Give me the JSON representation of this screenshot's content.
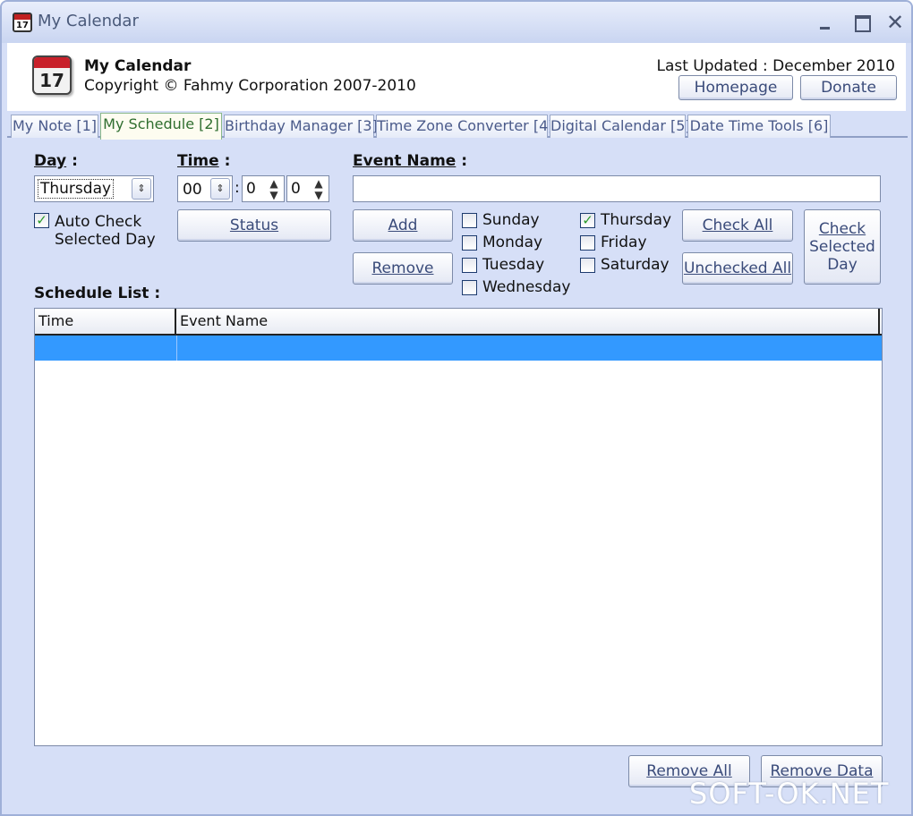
{
  "window": {
    "title": "My Calendar",
    "icon_day": "17"
  },
  "header": {
    "app_name": "My Calendar",
    "copyright": "Copyright © Fahmy Corporation 2007-2010",
    "last_updated": "Last Updated : December 2010",
    "homepage_label": "Homepage",
    "donate_label": "Donate"
  },
  "tabs": [
    {
      "label": "My Note [1]",
      "active": false
    },
    {
      "label": "My Schedule [2]",
      "active": true
    },
    {
      "label": "Birthday Manager [3]",
      "active": false
    },
    {
      "label": "Time Zone Converter [4]",
      "active": false
    },
    {
      "label": "Digital Calendar [5]",
      "active": false
    },
    {
      "label": "Date Time Tools [6]",
      "active": false
    }
  ],
  "form": {
    "day_label": "Day",
    "day_value": "Thursday",
    "auto_check": {
      "line1": "Auto Check",
      "line2": "Selected Day",
      "checked": true
    },
    "time_label": "Time",
    "time_hour": "00",
    "time_minute": "0",
    "time_second": "0",
    "status_label": "Status",
    "event_name_label": "Event Name",
    "event_name_value": "",
    "add_label": "Add",
    "remove_label": "Remove",
    "days": [
      {
        "label": "Sunday",
        "checked": false
      },
      {
        "label": "Monday",
        "checked": false
      },
      {
        "label": "Tuesday",
        "checked": false
      },
      {
        "label": "Wednesday",
        "checked": false
      },
      {
        "label": "Thursday",
        "checked": true
      },
      {
        "label": "Friday",
        "checked": false
      },
      {
        "label": "Saturday",
        "checked": false
      }
    ],
    "check_all_label": "Check All",
    "unchecked_all_label": "Unchecked All",
    "check_selected_day": {
      "line1": "Check",
      "line2": "Selected",
      "line3": "Day"
    }
  },
  "schedule": {
    "list_label": "Schedule List",
    "columns": [
      "Time",
      "Event Name"
    ],
    "rows": [
      {
        "time": "",
        "event": "",
        "selected": true
      }
    ],
    "remove_all_label": "Remove All",
    "remove_data_label": "Remove Data"
  },
  "watermark": "SOFT-OK.NET",
  "colors": {
    "window_bg": "#d6dff7",
    "selection": "#3399ff",
    "active_tab_text": "#2f6e2f",
    "check_mark": "#2a9a2a"
  }
}
